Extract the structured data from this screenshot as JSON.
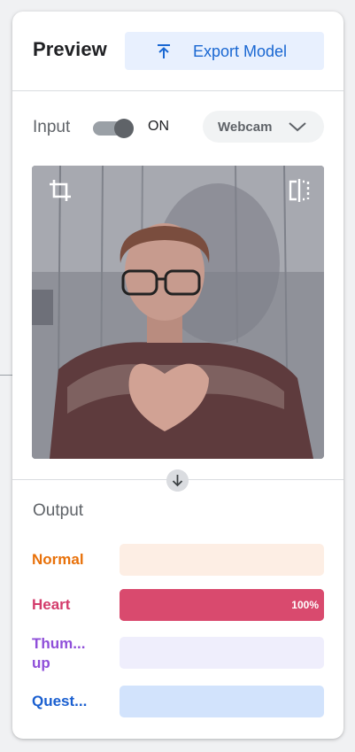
{
  "header": {
    "title": "Preview",
    "export_label": "Export Model"
  },
  "input": {
    "label": "Input",
    "toggle_state": "ON",
    "source": "Webcam"
  },
  "output": {
    "title": "Output",
    "classes": [
      {
        "name": "Normal",
        "name_lines": [
          "Normal"
        ],
        "color": "#e8710a",
        "track": "#fdeee4",
        "confidence": 0,
        "pct_label": ""
      },
      {
        "name": "Heart",
        "name_lines": [
          "Heart"
        ],
        "color": "#d33b6b",
        "track": "#d94a6e",
        "confidence": 1.0,
        "pct_label": "100%"
      },
      {
        "name": "Thum... up",
        "name_lines": [
          "Thum...",
          "up"
        ],
        "color": "#8f4fd9",
        "track": "#efeefc",
        "confidence": 0,
        "pct_label": ""
      },
      {
        "name": "Quest...",
        "name_lines": [
          "Quest..."
        ],
        "color": "#1a5fd0",
        "track": "#d2e3fc",
        "confidence": 0,
        "pct_label": ""
      }
    ]
  },
  "icons": {
    "export": "upload-icon",
    "dropdown": "chevron-down-icon",
    "crop": "crop-icon",
    "flip": "flip-horizontal-icon",
    "arrow": "arrow-down-icon"
  }
}
